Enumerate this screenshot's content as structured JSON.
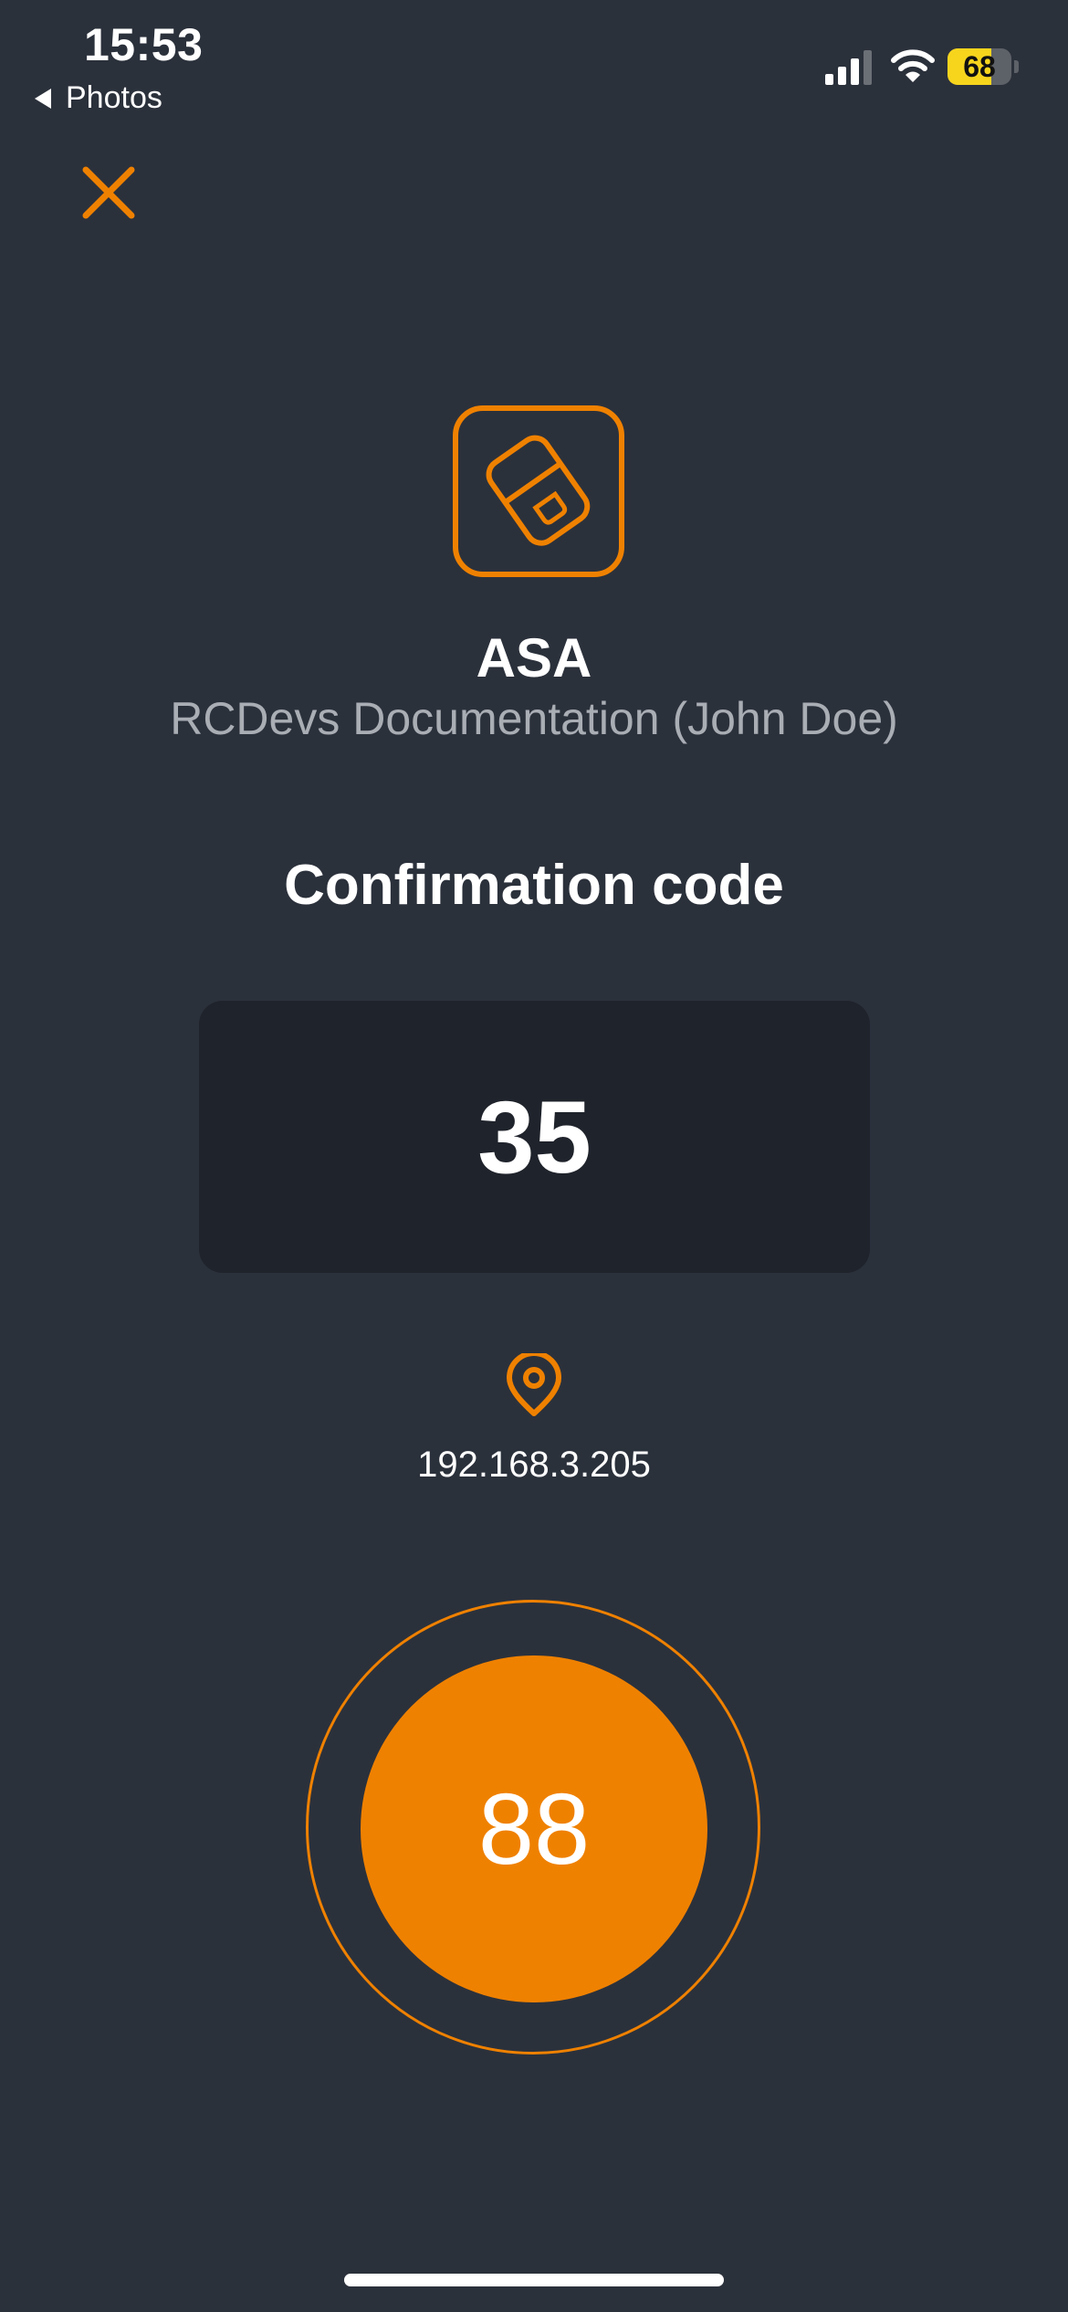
{
  "status_bar": {
    "time": "15:53",
    "back_label": "Photos",
    "battery_level": 68,
    "battery_text": "68",
    "battery_color": "#f7d51d",
    "signal_icon": "signal-bars-icon",
    "wifi_icon": "wifi-icon"
  },
  "header": {
    "close_icon": "close-icon"
  },
  "app": {
    "icon": "security-key-icon",
    "name": "ASA",
    "subtitle": "RCDevs Documentation (John Doe)"
  },
  "confirmation": {
    "title": "Confirmation code",
    "code": "35"
  },
  "location": {
    "icon": "location-pin-icon",
    "ip": "192.168.3.205"
  },
  "timer": {
    "value": "88"
  },
  "colors": {
    "background": "#2b313b",
    "accent": "#ef8100",
    "code_box": "#1f232b",
    "subtitle": "#a9adb4"
  }
}
